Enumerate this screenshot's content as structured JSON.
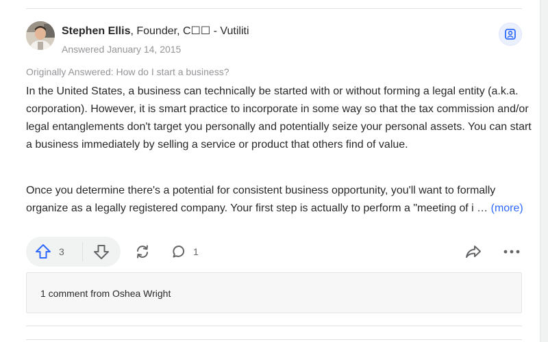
{
  "answer": {
    "author": {
      "name": "Stephen Ellis",
      "credential": ", Founder, C☐☐ - Vutiliti",
      "answered": "Answered January 14, 2015"
    },
    "originally_answered": "Originally Answered: How do I start a business?",
    "paragraph_1": "In the United States, a business can technically be started with or without forming a legal entity (a.k.a. corporation). However, it is smart practice to incorporate in some way so that the tax commission and/or legal entanglements don't target you personally and potentially seize your personal assets. You can start a business immediately by selling a service or product that others find of value.",
    "paragraph_2": "Once you determine there's a potential for consistent business opportunity, you'll want to formally organize as a legally registered company. Your first step is actually to perform a \"meeting of i … ",
    "more_label": "(more)"
  },
  "actions": {
    "upvote_count": "3",
    "comment_count": "1",
    "accent_color": "#2e69ff"
  },
  "comments": {
    "preview": "1 comment from Oshea Wright"
  },
  "icons": {
    "save": "save-person-icon",
    "upvote": "arrow-up-icon",
    "downvote": "arrow-down-icon",
    "reshare": "reshare-loop-icon",
    "comment": "speech-bubble-icon",
    "share": "share-arrow-icon",
    "more": "ellipsis-icon"
  }
}
